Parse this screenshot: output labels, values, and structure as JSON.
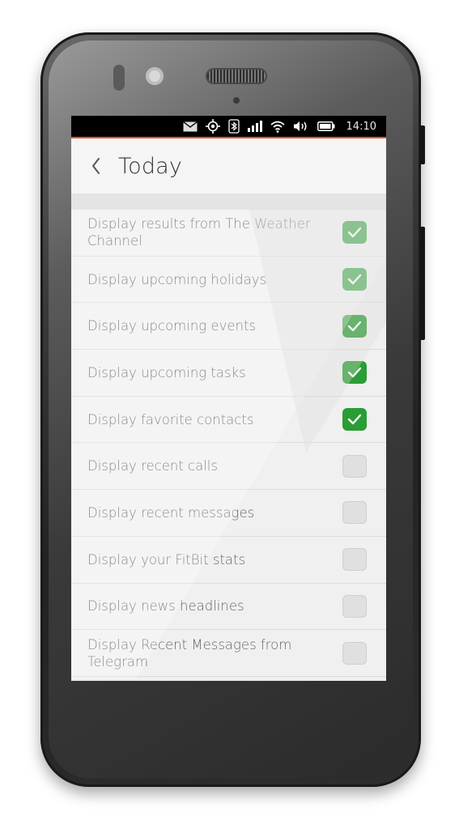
{
  "status_bar": {
    "time": "14:10",
    "icons": [
      "mail-icon",
      "location-icon",
      "bluetooth-icon",
      "signal-icon",
      "wifi-icon",
      "volume-icon",
      "battery-icon"
    ]
  },
  "header": {
    "back_icon": "chevron-left-icon",
    "title": "Today"
  },
  "settings": [
    {
      "label": "Display results from The Weather Channel",
      "checked": true
    },
    {
      "label": "Display upcoming holidays",
      "checked": true
    },
    {
      "label": "Display upcoming events",
      "checked": true
    },
    {
      "label": "Display upcoming tasks",
      "checked": true
    },
    {
      "label": "Display favorite contacts",
      "checked": true
    },
    {
      "label": "Display recent calls",
      "checked": false
    },
    {
      "label": "Display recent messages",
      "checked": false
    },
    {
      "label": "Display your FitBit stats",
      "checked": false
    },
    {
      "label": "Display news headlines",
      "checked": false
    },
    {
      "label": "Display Recent Messages from Telegram",
      "checked": false
    }
  ],
  "colors": {
    "accent": "#e95420",
    "checked": "#2a9d34"
  }
}
